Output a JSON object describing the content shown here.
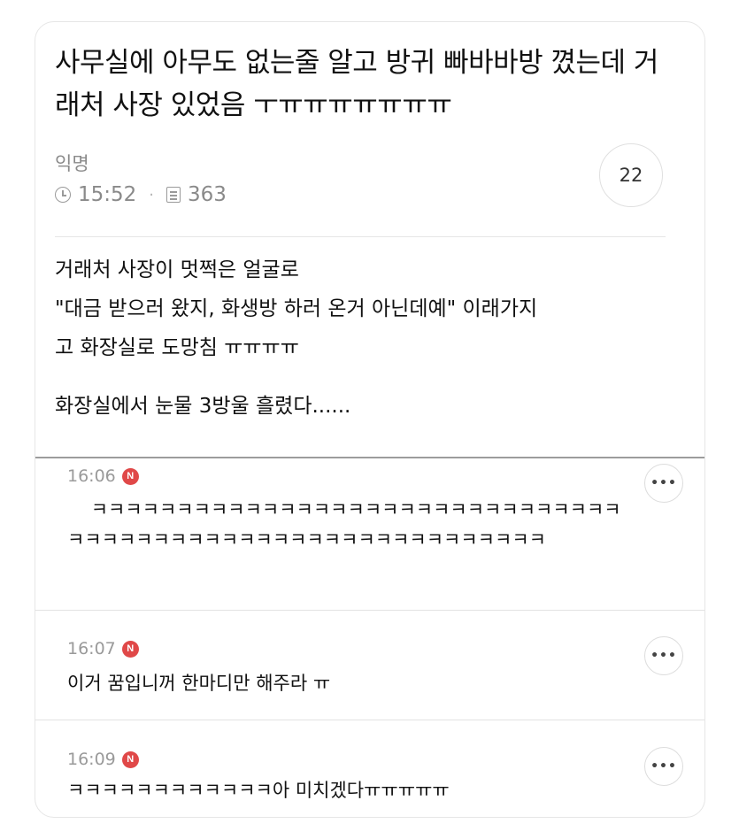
{
  "post": {
    "title": "사무실에 아무도 없는줄 알고 방귀 빠바바방 꼈는데 거래처 사장 있었음 ㅜㅠㅠㅠㅠㅠㅠㅠ",
    "author": "익명",
    "time": "15:52",
    "views": "363",
    "comment_count": "22",
    "body_lines": [
      "거래처 사장이 멋쩍은 얼굴로",
      "\"대금 받으러 왔지, 화생방 하러 온거 아닌데예\" 이래가지",
      "고 화장실로 도망침 ㅠㅠㅠㅠ",
      "화장실에서 눈물 3방울 흘렸다......"
    ]
  },
  "comments": [
    {
      "time": "16:06",
      "badge": "N",
      "text": "    ㅋㅋㅋㅋㅋㅋㅋㅋㅋㅋㅋㅋㅋㅋㅋㅋㅋㅋㅋㅋㅋㅋㅋㅋㅋㅋㅋㅋㅋㅋㅋㅋㅋㅋㅋㅋㅋㅋㅋㅋㅋㅋㅋㅋㅋㅋㅋㅋㅋㅋㅋㅋㅋㅋㅋㅋㅋㅋㅋ",
      "more": "•••"
    },
    {
      "time": "16:07",
      "badge": "N",
      "text": "이거 꿈입니꺼 한마디만 해주라 ㅠ",
      "more": "•••"
    },
    {
      "time": "16:09",
      "badge": "N",
      "text": "ㅋㅋㅋㅋㅋㅋㅋㅋㅋㅋㅋㅋ아 미치겠다ㅠㅠㅠㅠㅠ",
      "more": "•••"
    }
  ],
  "icons": {
    "time": "clock-icon",
    "views": "document-icon",
    "more": "more-icon"
  },
  "colors": {
    "new_badge": "#e04848",
    "muted_text": "#8a8a8a",
    "border": "#e6e6e6"
  }
}
